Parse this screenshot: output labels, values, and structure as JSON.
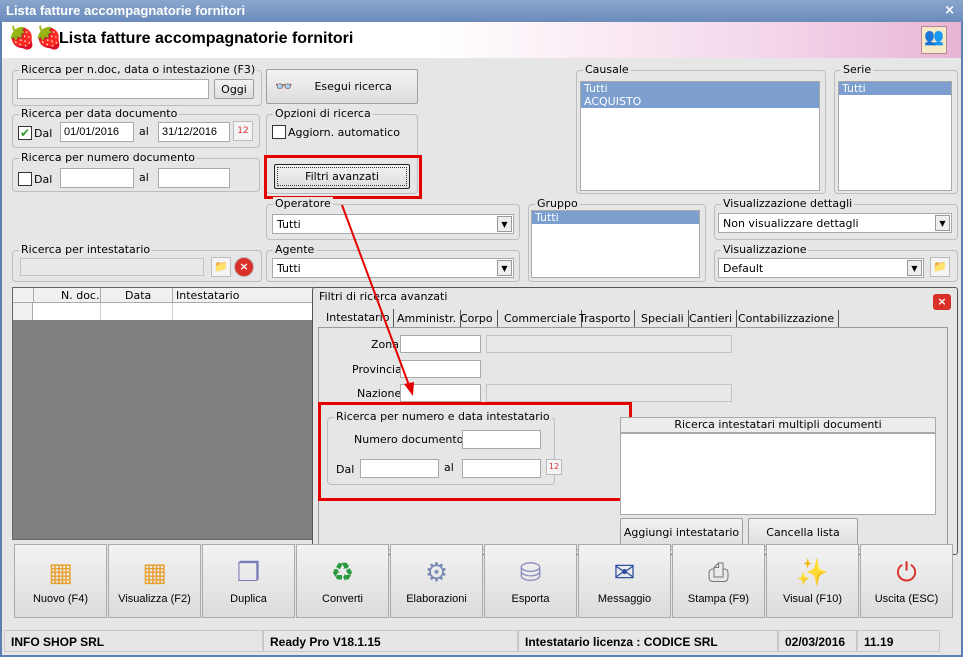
{
  "window": {
    "title": "Lista fatture accompagnatorie fornitori",
    "close": "×"
  },
  "header": {
    "title": "Lista fatture accompagnatorie fornitori",
    "logo_icon": "strawberries-icon",
    "right_icon": "users-icon"
  },
  "search_quick": {
    "legend": "Ricerca per n.doc, data o intestazione (F3)",
    "value": "",
    "today_button": "Oggi"
  },
  "run_search": {
    "label": "Esegui ricerca",
    "icon": "binoculars-icon"
  },
  "date_search": {
    "legend": "Ricerca per data documento",
    "checked": true,
    "from_label": "Dal",
    "from": "01/01/2016",
    "to_label": "al",
    "to": "31/12/2016"
  },
  "options": {
    "legend": "Opzioni di ricerca",
    "auto_update": "Aggiorn. automatico",
    "auto_update_checked": false,
    "advanced_button": "Filtri avanzati"
  },
  "number_search": {
    "legend": "Ricerca per numero documento",
    "checked": false,
    "from_label": "Dal",
    "to_label": "al",
    "from": "",
    "to": ""
  },
  "operator": {
    "legend": "Operatore",
    "value": "Tutti"
  },
  "agent": {
    "legend": "Agente",
    "value": "Tutti"
  },
  "holder": {
    "legend": "Ricerca per intestatario",
    "value": ""
  },
  "causale": {
    "legend": "Causale",
    "items": [
      "Tutti",
      "ACQUISTO"
    ]
  },
  "serie": {
    "legend": "Serie",
    "items": [
      "Tutti"
    ]
  },
  "gruppo": {
    "legend": "Gruppo",
    "items": [
      "Tutti"
    ]
  },
  "details_view": {
    "legend": "Visualizzazione dettagli",
    "value": "Non visualizzare dettagli"
  },
  "view": {
    "legend": "Visualizzazione",
    "value": "Default"
  },
  "grid": {
    "columns": [
      "N. doc.",
      "Data",
      "Intestatario"
    ]
  },
  "advanced": {
    "title": "Filtri di ricerca avanzati",
    "tabs": [
      "Intestatario",
      "Amministr.",
      "Corpo",
      "Commerciale",
      "Trasporto",
      "Speciali",
      "Cantieri",
      "Contabilizzazione"
    ],
    "zona": "Zona",
    "provincia": "Provincia",
    "nazione": "Nazione",
    "num_date_group": {
      "legend": "Ricerca per numero e data intestatario",
      "number_label": "Numero documento :",
      "from_label": "Dal",
      "to_label": "al"
    },
    "multi": {
      "header": "Ricerca intestatari multipli documenti",
      "add_button": "Aggiungi intestatario",
      "clear_button": "Cancella lista"
    }
  },
  "toolbar": [
    {
      "label": "Nuovo (F4)",
      "icon": "grid-add-icon",
      "glyph": "▦"
    },
    {
      "label": "Visualizza (F2)",
      "icon": "grid-check-icon",
      "glyph": "▦"
    },
    {
      "label": "Duplica",
      "icon": "duplicate-icon",
      "glyph": "❐"
    },
    {
      "label": "Converti",
      "icon": "convert-icon",
      "glyph": "♻"
    },
    {
      "label": "Elaborazioni",
      "icon": "gear-document-icon",
      "glyph": "⚙"
    },
    {
      "label": "Esporta",
      "icon": "database-export-icon",
      "glyph": "⛁"
    },
    {
      "label": "Messaggio",
      "icon": "mail-icon",
      "glyph": "✉"
    },
    {
      "label": "Stampa (F9)",
      "icon": "printer-icon",
      "glyph": "⎙"
    },
    {
      "label": "Visual (F10)",
      "icon": "magic-wand-icon",
      "glyph": "✨"
    },
    {
      "label": "Uscita (ESC)",
      "icon": "power-icon",
      "glyph": "⏻"
    }
  ],
  "status": {
    "company": "INFO SHOP SRL",
    "version": "Ready Pro V18.1.15",
    "license": "Intestatario licenza : CODICE SRL",
    "date": "02/03/2016",
    "time": "11.19"
  },
  "colors": {
    "highlight": "#e40000",
    "selection": "#7d9fcf",
    "titlebar": "#6a8bbb"
  }
}
